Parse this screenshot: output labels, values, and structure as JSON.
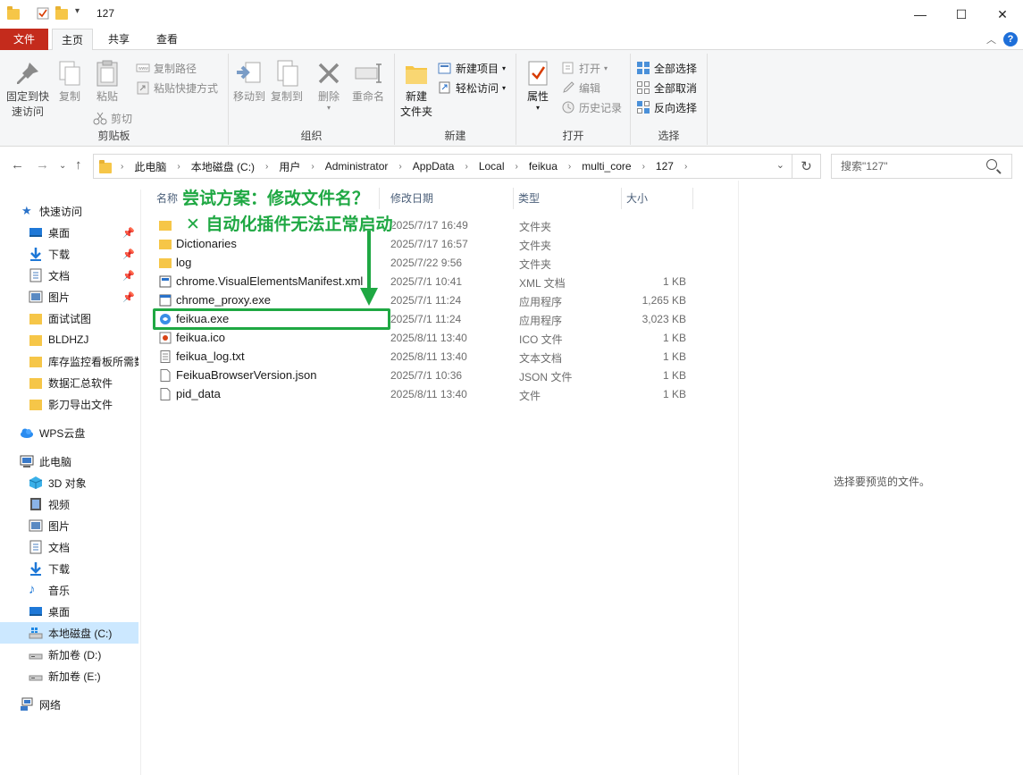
{
  "window": {
    "title": "127"
  },
  "tabs": {
    "file": "文件",
    "home": "主页",
    "share": "共享",
    "view": "查看"
  },
  "ribbon": {
    "clipboard": {
      "pin_label": "固定到快\n速访问",
      "copy_label": "复制",
      "paste_label": "粘贴",
      "copy_path": "复制路径",
      "paste_shortcut": "粘贴快捷方式",
      "cut": "剪切",
      "group": "剪贴板"
    },
    "organize": {
      "move_to": "移动到",
      "copy_to": "复制到",
      "delete": "删除",
      "rename": "重命名",
      "group": "组织"
    },
    "new": {
      "new_folder": "新建\n文件夹",
      "new_item": "新建项目",
      "easy_access": "轻松访问",
      "group": "新建"
    },
    "open": {
      "properties": "属性",
      "open": "打开",
      "edit": "编辑",
      "history": "历史记录",
      "group": "打开"
    },
    "select": {
      "select_all": "全部选择",
      "select_none": "全部取消",
      "invert": "反向选择",
      "group": "选择"
    }
  },
  "address": {
    "crumbs": [
      "此电脑",
      "本地磁盘 (C:)",
      "用户",
      "Administrator",
      "AppData",
      "Local",
      "feikua",
      "multi_core",
      "127"
    ]
  },
  "search": {
    "placeholder": "搜索\"127\""
  },
  "sidebar": {
    "quick_access": "快速访问",
    "quick_items": [
      "桌面",
      "下载",
      "文档",
      "图片",
      "面试试图",
      "BLDHZJ",
      "库存监控看板所需数",
      "数据汇总软件",
      "影刀导出文件"
    ],
    "wps": "WPS云盘",
    "this_pc": "此电脑",
    "pc_items": [
      "3D 对象",
      "视频",
      "图片",
      "文档",
      "下载",
      "音乐",
      "桌面",
      "本地磁盘 (C:)",
      "新加卷 (D:)",
      "新加卷 (E:)"
    ],
    "network": "网络"
  },
  "columns": {
    "name": "名称",
    "modified": "修改日期",
    "type": "类型",
    "size": "大小"
  },
  "files": [
    {
      "name": "",
      "date": "2025/7/17 16:49",
      "type": "文件夹",
      "size": "",
      "icon": "folder-icon"
    },
    {
      "name": "Dictionaries",
      "date": "2025/7/17 16:57",
      "type": "文件夹",
      "size": "",
      "icon": "folder-icon"
    },
    {
      "name": "log",
      "date": "2025/7/22 9:56",
      "type": "文件夹",
      "size": "",
      "icon": "folder-icon"
    },
    {
      "name": "chrome.VisualElementsManifest.xml",
      "date": "2025/7/1 10:41",
      "type": "XML 文档",
      "size": "1 KB",
      "icon": "xml-icon"
    },
    {
      "name": "chrome_proxy.exe",
      "date": "2025/7/1 11:24",
      "type": "应用程序",
      "size": "1,265 KB",
      "icon": "exe-icon"
    },
    {
      "name": "feikua.exe",
      "date": "2025/7/1 11:24",
      "type": "应用程序",
      "size": "3,023 KB",
      "icon": "app-icon"
    },
    {
      "name": "feikua.ico",
      "date": "2025/8/11 13:40",
      "type": "ICO 文件",
      "size": "1 KB",
      "icon": "image-icon"
    },
    {
      "name": "feikua_log.txt",
      "date": "2025/8/11 13:40",
      "type": "文本文档",
      "size": "1 KB",
      "icon": "text-icon"
    },
    {
      "name": "FeikuaBrowserVersion.json",
      "date": "2025/7/1 10:36",
      "type": "JSON 文件",
      "size": "1 KB",
      "icon": "file-icon"
    },
    {
      "name": "pid_data",
      "date": "2025/8/11 13:40",
      "type": "文件",
      "size": "1 KB",
      "icon": "file-icon"
    }
  ],
  "preview": {
    "empty": "选择要预览的文件。"
  },
  "annotation": {
    "line1": "尝试方案：修改文件名？",
    "line2": "✕ 自动化插件无法正常启动",
    "color": "#1fa843"
  }
}
